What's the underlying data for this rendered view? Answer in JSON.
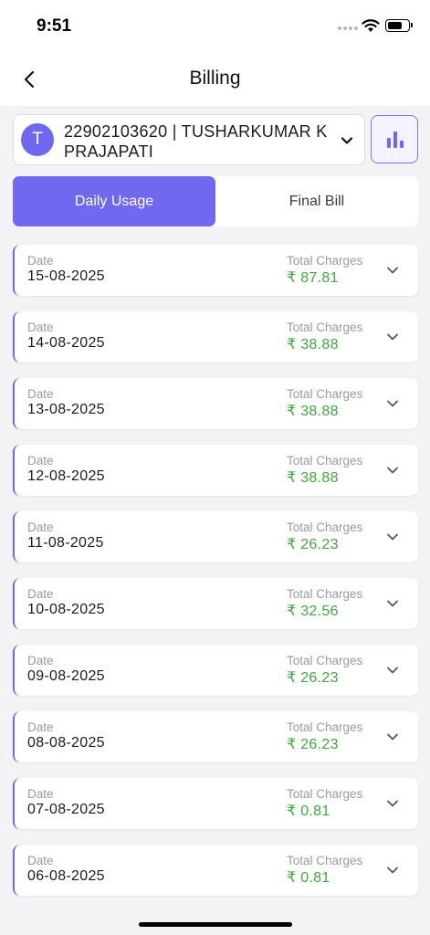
{
  "status_bar": {
    "time": "9:51"
  },
  "header": {
    "title": "Billing"
  },
  "account": {
    "avatar_letter": "T",
    "label": "22902103620 | TUSHARKUMAR K PRAJAPATI"
  },
  "tabs": [
    {
      "label": "Daily Usage",
      "active": true
    },
    {
      "label": "Final Bill",
      "active": false
    }
  ],
  "usage": {
    "date_caption": "Date",
    "charges_caption": "Total Charges",
    "rows": [
      {
        "date": "15-08-2025",
        "charges": "₹ 87.81"
      },
      {
        "date": "14-08-2025",
        "charges": "₹ 38.88"
      },
      {
        "date": "13-08-2025",
        "charges": "₹ 38.88"
      },
      {
        "date": "12-08-2025",
        "charges": "₹ 38.88"
      },
      {
        "date": "11-08-2025",
        "charges": "₹ 26.23"
      },
      {
        "date": "10-08-2025",
        "charges": "₹ 32.56"
      },
      {
        "date": "09-08-2025",
        "charges": "₹ 26.23"
      },
      {
        "date": "08-08-2025",
        "charges": "₹ 26.23"
      },
      {
        "date": "07-08-2025",
        "charges": "₹ 0.81"
      },
      {
        "date": "06-08-2025",
        "charges": "₹ 0.81"
      }
    ]
  },
  "colors": {
    "accent": "#7068ee",
    "charges_green": "#3caa3c",
    "background": "#f3f3f6"
  },
  "icons": {
    "back": "chevron-left-icon",
    "dropdown": "chevron-down-icon",
    "chart": "bar-chart-icon"
  }
}
